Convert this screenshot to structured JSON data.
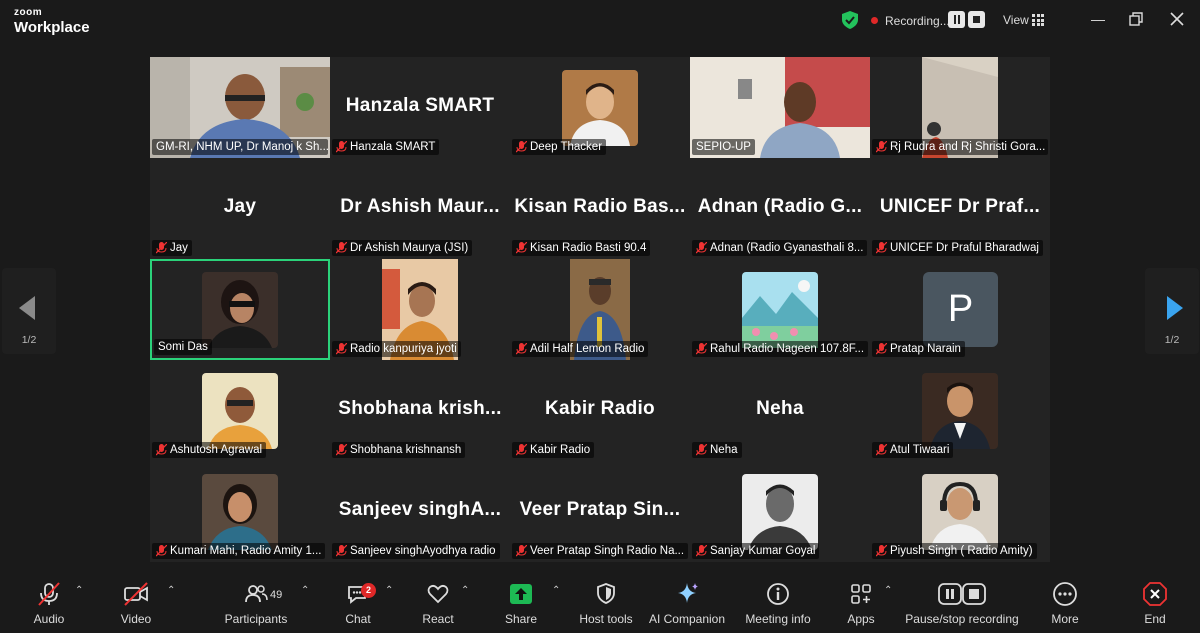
{
  "app": {
    "brand_small": "zoom",
    "brand_large": "Workplace"
  },
  "topbar": {
    "recording_label": "Recording...",
    "view_label": "View"
  },
  "pagination": {
    "left": "1/2",
    "right": "1/2"
  },
  "tiles": [
    {
      "label": "GM-RI, NHM UP, Dr Manoj k Sh...",
      "big": "",
      "muted": false
    },
    {
      "label": "Hanzala SMART",
      "big": "Hanzala SMART",
      "muted": true
    },
    {
      "label": "Deep Thacker",
      "big": "",
      "muted": true
    },
    {
      "label": "SEPIO-UP",
      "big": "",
      "muted": false
    },
    {
      "label": "Rj Rudra and Rj Shristi Gora...",
      "big": "",
      "muted": true
    },
    {
      "label": "Jay",
      "big": "Jay",
      "muted": true
    },
    {
      "label": "Dr Ashish Maurya (JSI)",
      "big": "Dr Ashish Maur...",
      "muted": true
    },
    {
      "label": "Kisan Radio Basti 90.4",
      "big": "Kisan Radio Bas...",
      "muted": true
    },
    {
      "label": "Adnan (Radio Gyanasthali 8...",
      "big": "Adnan (Radio G...",
      "muted": true
    },
    {
      "label": "UNICEF Dr Praful Bharadwaj",
      "big": "UNICEF Dr Praf...",
      "muted": true
    },
    {
      "label": "Somi Das",
      "big": "",
      "muted": false
    },
    {
      "label": "Radio kanpuriya jyoti",
      "big": "",
      "muted": true
    },
    {
      "label": "Adil Half Lemon Radio",
      "big": "",
      "muted": true
    },
    {
      "label": "Rahul Radio Nageen 107.8F...",
      "big": "",
      "muted": true
    },
    {
      "label": "Pratap Narain",
      "big": "",
      "muted": true,
      "avatar_letter": "P"
    },
    {
      "label": "Ashutosh Agrawal",
      "big": "",
      "muted": true
    },
    {
      "label": "Shobhana krishnansh",
      "big": "Shobhana krish...",
      "muted": true
    },
    {
      "label": "Kabir Radio",
      "big": "Kabir Radio",
      "muted": true
    },
    {
      "label": "Neha",
      "big": "Neha",
      "muted": true
    },
    {
      "label": "Atul Tiwaari",
      "big": "",
      "muted": true
    },
    {
      "label": "Kumari Mahi, Radio Amity 1...",
      "big": "",
      "muted": true
    },
    {
      "label": "Sanjeev singhAyodhya radio",
      "big": "Sanjeev singhA...",
      "muted": true
    },
    {
      "label": "Veer Pratap Singh Radio Na...",
      "big": "Veer Pratap Sin...",
      "muted": true
    },
    {
      "label": "Sanjay Kumar Goyal",
      "big": "",
      "muted": true
    },
    {
      "label": "Piyush Singh ( Radio Amity)",
      "big": "",
      "muted": true
    }
  ],
  "toolbar": {
    "audio": "Audio",
    "video": "Video",
    "participants": "Participants",
    "participants_count": "49",
    "chat": "Chat",
    "chat_badge": "2",
    "react": "React",
    "share": "Share",
    "host_tools": "Host tools",
    "ai_companion": "AI Companion",
    "meeting_info": "Meeting info",
    "apps": "Apps",
    "pause_stop": "Pause/stop recording",
    "more": "More",
    "end": "End"
  },
  "colors": {
    "active_border": "#2bd27a",
    "share_green": "#1db954",
    "record_red": "#e02828",
    "nav_arrow": "#3aa4ef"
  }
}
